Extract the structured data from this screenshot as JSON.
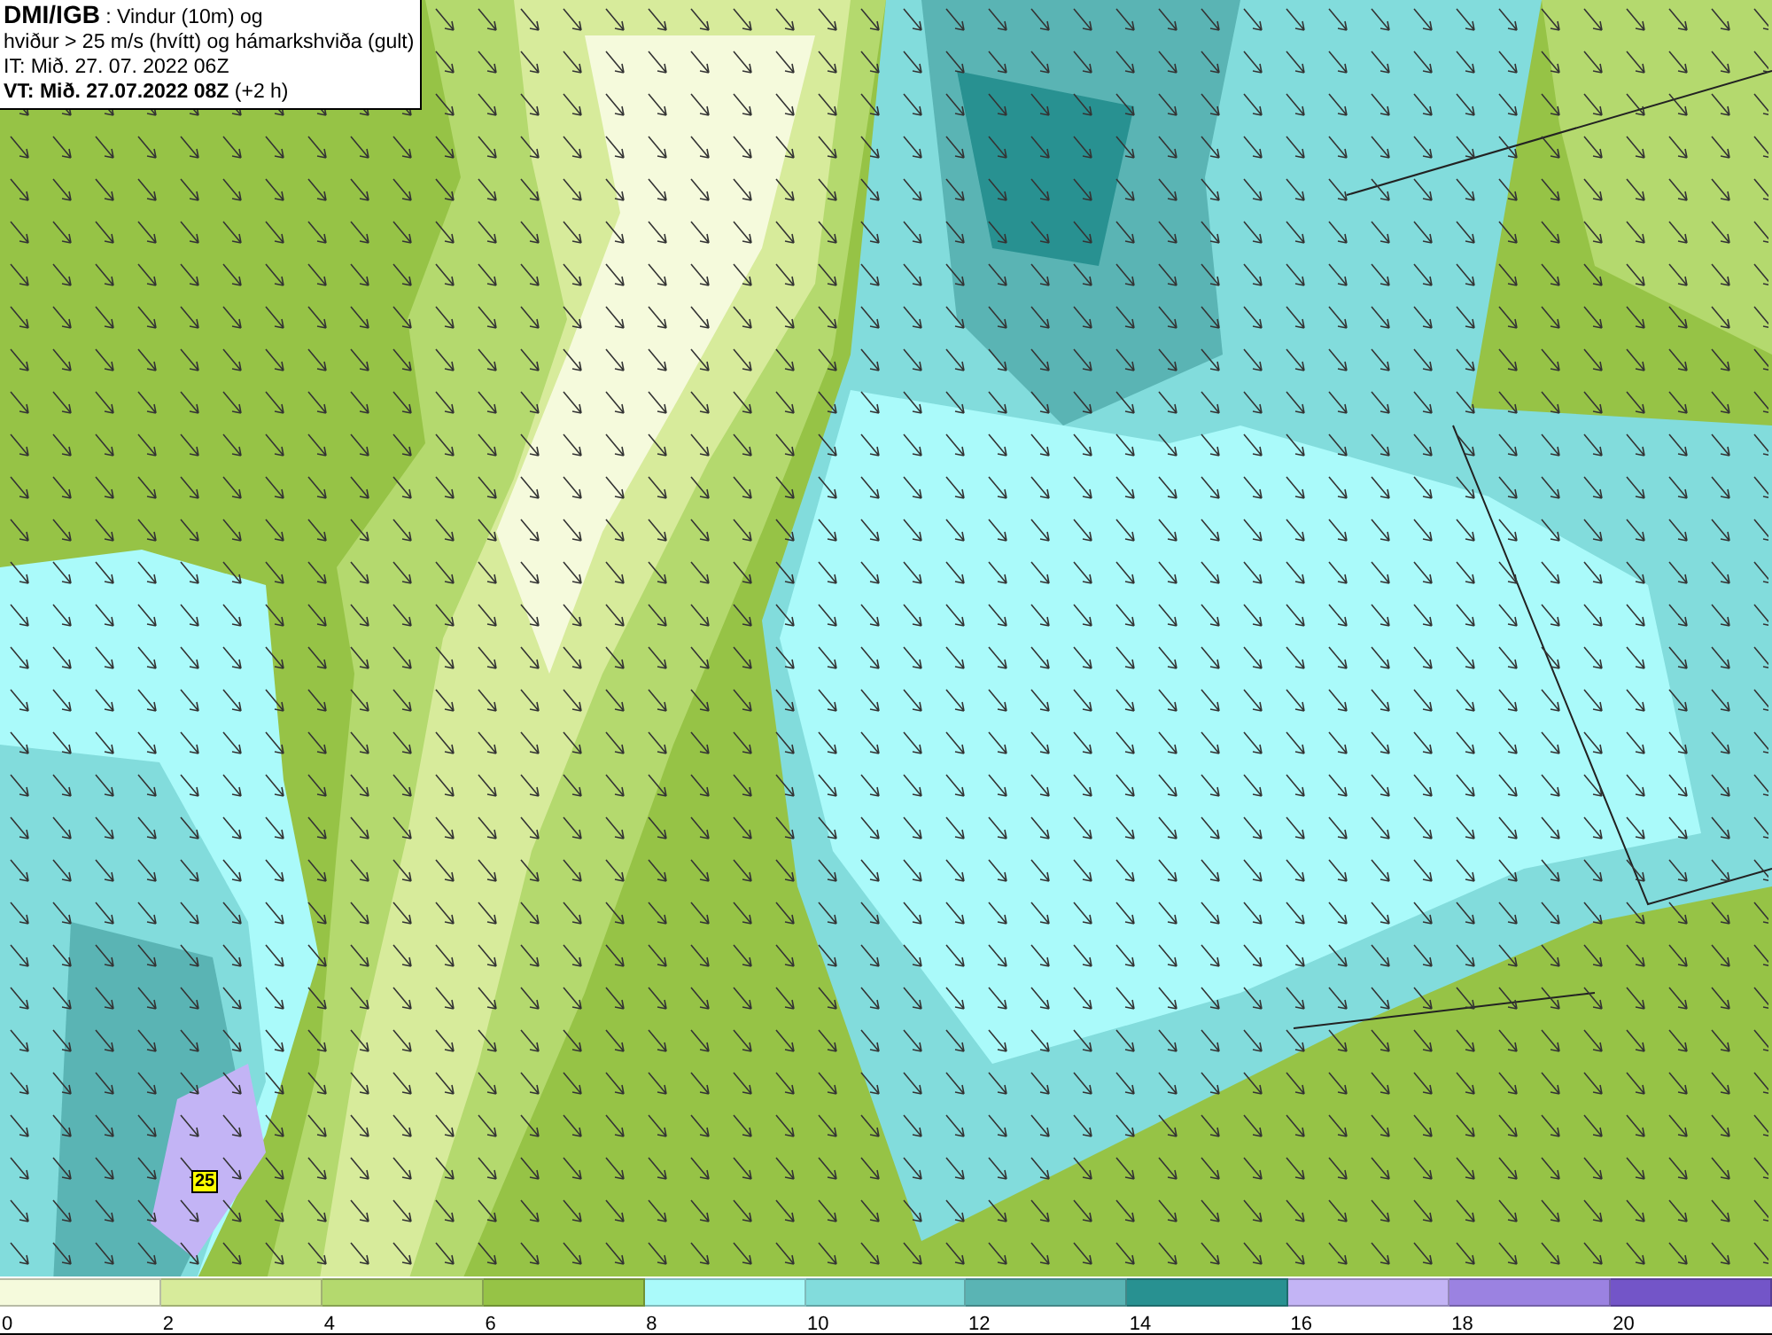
{
  "header": {
    "lines": [
      "**DMI/IGB** : Vindur (10m) og",
      "hviður > 25 m/s (hvítt) og hámarkshviða (gult)",
      "IT: Mið. 27. 07. 2022 06Z",
      "**VT: Mið. 27.07.2022 08Z** (+2 h)"
    ]
  },
  "map": {
    "gust_markers": [
      {
        "label": "25"
      }
    ]
  },
  "legend": [
    {
      "label": "0",
      "color": "#f5fadc"
    },
    {
      "label": "2",
      "color": "#d7eb9b"
    },
    {
      "label": "4",
      "color": "#b4d96e"
    },
    {
      "label": "6",
      "color": "#96c346"
    },
    {
      "label": "8",
      "color": "#aafafa"
    },
    {
      "label": "10",
      "color": "#82dcdc"
    },
    {
      "label": "12",
      "color": "#5ab4b4"
    },
    {
      "label": "14",
      "color": "#289191"
    },
    {
      "label": "16",
      "color": "#c3b4f5"
    },
    {
      "label": "18",
      "color": "#9b82e1"
    },
    {
      "label": "20",
      "color": "#7355c8"
    }
  ]
}
